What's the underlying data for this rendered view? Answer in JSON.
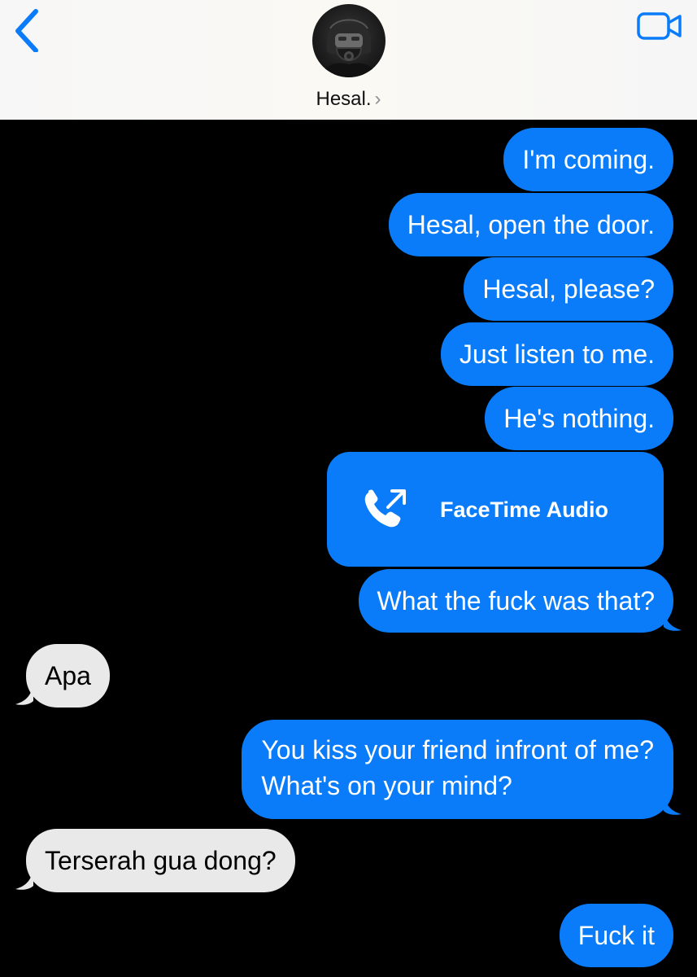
{
  "header": {
    "contact_name": "Hesal.",
    "chevron": "›",
    "back_icon": "chevron-left-icon",
    "video_icon": "video-camera-icon"
  },
  "messages": [
    {
      "direction": "outgoing",
      "text": "I'm coming."
    },
    {
      "direction": "outgoing",
      "text": "Hesal, open the door."
    },
    {
      "direction": "outgoing",
      "text": "Hesal, please?"
    },
    {
      "direction": "outgoing",
      "text": "Just listen to me."
    },
    {
      "direction": "outgoing",
      "text": "He's nothing."
    },
    {
      "direction": "outgoing",
      "type": "call",
      "text": "FaceTime Audio",
      "icon": "outgoing-call-icon"
    },
    {
      "direction": "outgoing",
      "text": "What the fuck was that?"
    },
    {
      "direction": "incoming",
      "text": "Apa"
    },
    {
      "direction": "outgoing",
      "lines": [
        "You kiss your friend infront of me?",
        "What's on your mind?"
      ]
    },
    {
      "direction": "incoming",
      "text": "Terserah gua dong?"
    },
    {
      "direction": "outgoing",
      "text": "Fuck it"
    }
  ],
  "colors": {
    "outgoing_bubble": "#0a7cf9",
    "incoming_bubble": "#e9e9ea",
    "background": "#000000",
    "accent": "#0a7cf9"
  }
}
